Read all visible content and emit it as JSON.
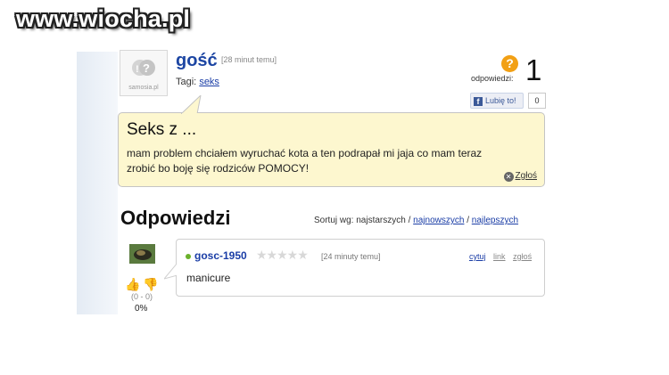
{
  "watermark": "www.wiocha.pl",
  "question": {
    "author": "gość",
    "time_ago": "[28 minut temu]",
    "tags_label": "Tagi:",
    "tag": "seks",
    "avatar_label": "samosia.pl",
    "answers_label": "odpowiedzi:",
    "answers_count": "1",
    "answers_icon": "question-mark-icon",
    "like_label": "Lubię to!",
    "like_count": "0",
    "title": "Seks z ...",
    "body": "mam problem chciałem wyruchać kota a ten podrapał mi jaja co mam teraz zrobić bo boję się rodziców POMOCY!",
    "report_label": "Zgłoś"
  },
  "answers_section": {
    "title": "Odpowiedzi",
    "sort_label": "Sortuj wg:",
    "sort_options": [
      "najstarszych",
      "najnowszych",
      "najlepszych"
    ]
  },
  "answer": {
    "author": "gosc-1950",
    "rating_stars": 0,
    "time_ago": "[24 minuty temu]",
    "links": [
      "cytuj",
      "link",
      "zgłoś"
    ],
    "text": "manicure",
    "votes": "(0 - 0)",
    "percent": "0%"
  },
  "colors": {
    "link": "#1a3da6",
    "question_bg": "#fdf7cf",
    "badge": "#f2a014"
  }
}
